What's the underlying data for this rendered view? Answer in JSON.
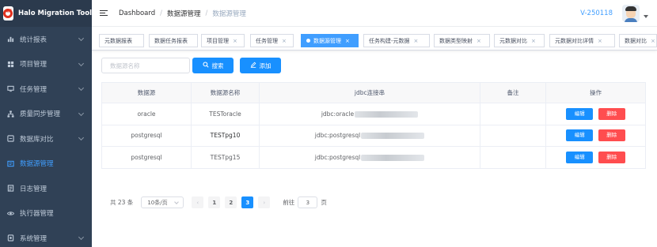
{
  "app": {
    "title": "Halo Migration Tool",
    "logo_text": "瀚高"
  },
  "sidebar": {
    "items": [
      {
        "label": "统计报表",
        "icon": "chart-icon",
        "expandable": true
      },
      {
        "label": "项目管理",
        "icon": "grid-icon",
        "expandable": true
      },
      {
        "label": "任务管理",
        "icon": "monitor-icon",
        "expandable": true
      },
      {
        "label": "质量同步管理",
        "icon": "tree-icon",
        "expandable": true
      },
      {
        "label": "数据库对比",
        "icon": "compare-icon",
        "expandable": true
      },
      {
        "label": "数据源管理",
        "icon": "datasource-icon",
        "expandable": false,
        "active": true
      },
      {
        "label": "日志管理",
        "icon": "log-icon",
        "expandable": false
      },
      {
        "label": "执行器管理",
        "icon": "eye-icon",
        "expandable": false
      },
      {
        "label": "系统管理",
        "icon": "system-icon",
        "expandable": true
      }
    ]
  },
  "header": {
    "breadcrumb": [
      "Dashboard",
      "数据源管理",
      "数据源管理"
    ],
    "version": "V-250118"
  },
  "tags": [
    {
      "label": "元数据报表",
      "closable": false
    },
    {
      "label": "数据任务报表",
      "closable": false
    },
    {
      "label": "项目管理",
      "closable": true
    },
    {
      "label": "任务管理",
      "closable": true
    },
    {
      "label": "数据源管理",
      "closable": true,
      "active": true
    },
    {
      "label": "任务构建-元数据",
      "closable": true
    },
    {
      "label": "数据类型映射",
      "closable": true
    },
    {
      "label": "元数据对比",
      "closable": true
    },
    {
      "label": "元数据对比详情",
      "closable": true
    },
    {
      "label": "数据对比",
      "closable": true
    }
  ],
  "toolbar": {
    "search_placeholder": "数据源名称",
    "search_value": "",
    "search_label": "搜索",
    "add_label": "添加"
  },
  "table": {
    "columns": [
      "数据源",
      "数据源名称",
      "jdbc连接串",
      "备注",
      "操作"
    ],
    "rows": [
      {
        "source": "oracle",
        "name": "TESToracle",
        "jdbc": "jdbc:oracle",
        "note": "",
        "name_bold": false
      },
      {
        "source": "postgresql",
        "name": "TESTpg10",
        "jdbc": "jdbc:postgresql",
        "note": "",
        "name_bold": true
      },
      {
        "source": "postgresql",
        "name": "TESTpg15",
        "jdbc": "jdbc:postgresql",
        "note": "",
        "name_bold": false
      }
    ],
    "edit_label": "编辑",
    "delete_label": "删除"
  },
  "pagination": {
    "total_text": "共 23 条",
    "page_size": "10条/页",
    "pages": [
      "1",
      "2",
      "3"
    ],
    "current_page": "3",
    "prev": "‹",
    "next": "›",
    "goto_label": "前往",
    "goto_value": "3",
    "page_suffix": "页"
  },
  "colors": {
    "sidebar_bg": "#304156",
    "primary": "#1890ff",
    "danger": "#ff4d4f",
    "active_menu": "#409eff"
  }
}
